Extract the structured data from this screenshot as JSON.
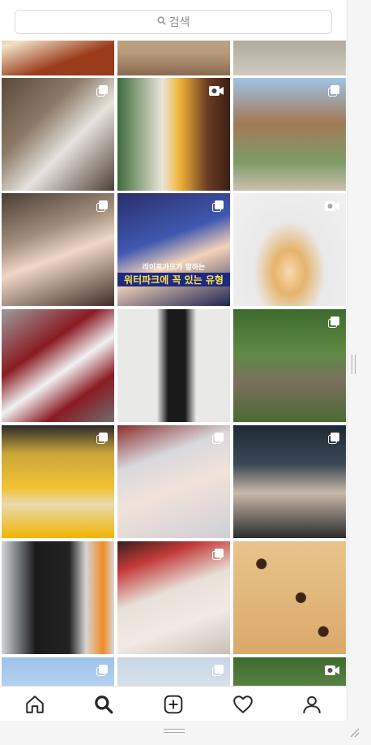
{
  "search": {
    "placeholder": "검색"
  },
  "tiles": [
    {
      "caption": "",
      "badge": "none"
    },
    {
      "caption": "",
      "badge": "none"
    },
    {
      "caption": "",
      "badge": "none"
    },
    {
      "caption": "",
      "badge": "carousel-icon"
    },
    {
      "caption": "",
      "badge": "video-icon"
    },
    {
      "caption": "",
      "badge": "carousel-icon"
    },
    {
      "caption": "",
      "badge": "carousel-icon"
    },
    {
      "caption": "",
      "badge": "carousel-icon"
    },
    {
      "caption": "",
      "badge": "video-icon"
    },
    {
      "caption": "",
      "badge": "none"
    },
    {
      "caption": "",
      "badge": "none"
    },
    {
      "caption": "",
      "badge": "carousel-icon"
    },
    {
      "caption": "",
      "badge": "carousel-icon"
    },
    {
      "caption": "",
      "badge": "carousel-icon"
    },
    {
      "caption": "",
      "badge": "carousel-icon"
    },
    {
      "caption": "",
      "badge": "none"
    },
    {
      "caption": "",
      "badge": "carousel-icon"
    },
    {
      "caption": "",
      "badge": "none"
    },
    {
      "caption": "",
      "badge": "carousel-icon"
    },
    {
      "caption": "",
      "badge": "carousel-icon"
    },
    {
      "caption": "",
      "badge": "video-icon"
    }
  ],
  "video_overlay": {
    "line1": "라이프가드가 말하는",
    "line2": "워터파크에 꼭 있는 유형"
  },
  "nav": [
    "home-icon",
    "search-icon",
    "new-post-icon",
    "activity-heart-icon",
    "profile-icon"
  ]
}
